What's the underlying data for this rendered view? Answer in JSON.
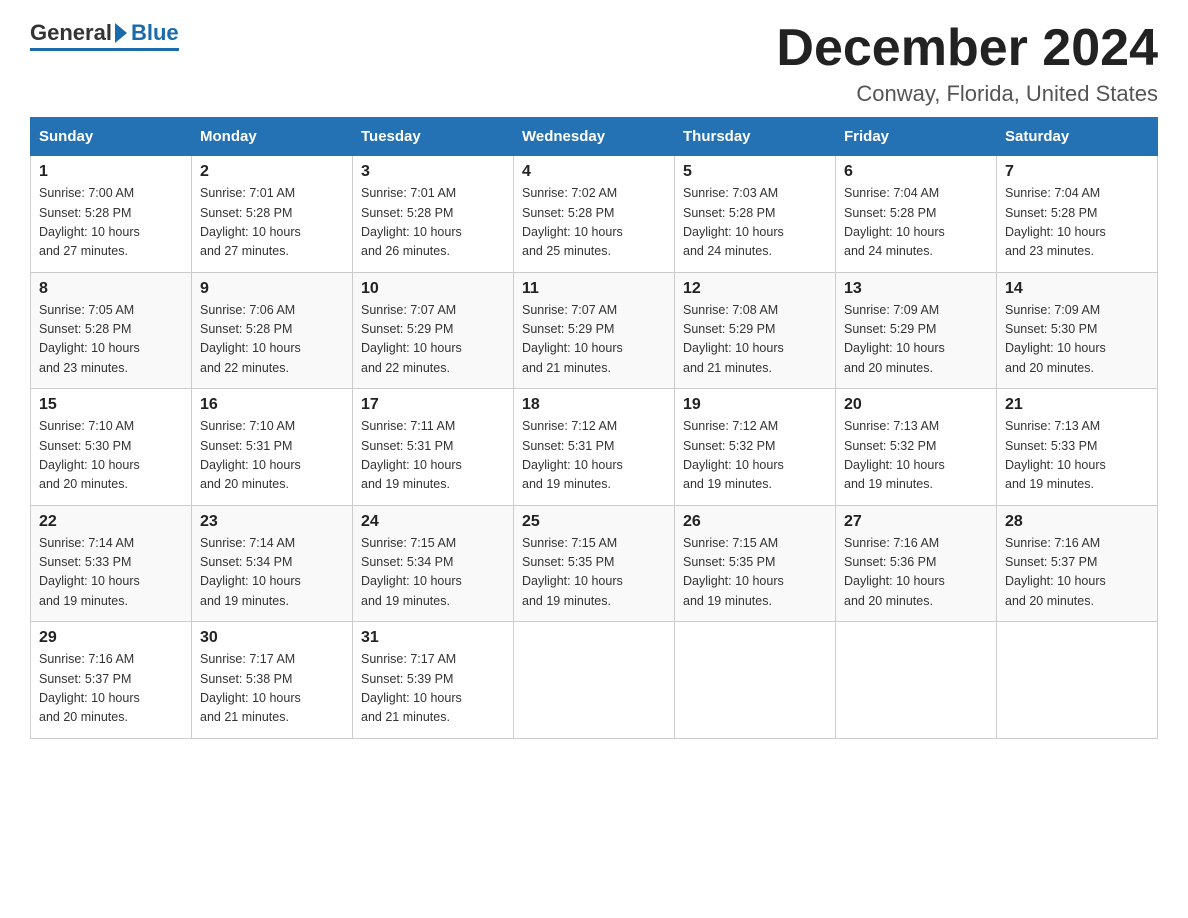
{
  "header": {
    "logo_general": "General",
    "logo_blue": "Blue",
    "month_title": "December 2024",
    "location": "Conway, Florida, United States"
  },
  "days_of_week": [
    "Sunday",
    "Monday",
    "Tuesday",
    "Wednesday",
    "Thursday",
    "Friday",
    "Saturday"
  ],
  "weeks": [
    [
      {
        "num": "1",
        "sunrise": "7:00 AM",
        "sunset": "5:28 PM",
        "daylight": "10 hours and 27 minutes."
      },
      {
        "num": "2",
        "sunrise": "7:01 AM",
        "sunset": "5:28 PM",
        "daylight": "10 hours and 27 minutes."
      },
      {
        "num": "3",
        "sunrise": "7:01 AM",
        "sunset": "5:28 PM",
        "daylight": "10 hours and 26 minutes."
      },
      {
        "num": "4",
        "sunrise": "7:02 AM",
        "sunset": "5:28 PM",
        "daylight": "10 hours and 25 minutes."
      },
      {
        "num": "5",
        "sunrise": "7:03 AM",
        "sunset": "5:28 PM",
        "daylight": "10 hours and 24 minutes."
      },
      {
        "num": "6",
        "sunrise": "7:04 AM",
        "sunset": "5:28 PM",
        "daylight": "10 hours and 24 minutes."
      },
      {
        "num": "7",
        "sunrise": "7:04 AM",
        "sunset": "5:28 PM",
        "daylight": "10 hours and 23 minutes."
      }
    ],
    [
      {
        "num": "8",
        "sunrise": "7:05 AM",
        "sunset": "5:28 PM",
        "daylight": "10 hours and 23 minutes."
      },
      {
        "num": "9",
        "sunrise": "7:06 AM",
        "sunset": "5:28 PM",
        "daylight": "10 hours and 22 minutes."
      },
      {
        "num": "10",
        "sunrise": "7:07 AM",
        "sunset": "5:29 PM",
        "daylight": "10 hours and 22 minutes."
      },
      {
        "num": "11",
        "sunrise": "7:07 AM",
        "sunset": "5:29 PM",
        "daylight": "10 hours and 21 minutes."
      },
      {
        "num": "12",
        "sunrise": "7:08 AM",
        "sunset": "5:29 PM",
        "daylight": "10 hours and 21 minutes."
      },
      {
        "num": "13",
        "sunrise": "7:09 AM",
        "sunset": "5:29 PM",
        "daylight": "10 hours and 20 minutes."
      },
      {
        "num": "14",
        "sunrise": "7:09 AM",
        "sunset": "5:30 PM",
        "daylight": "10 hours and 20 minutes."
      }
    ],
    [
      {
        "num": "15",
        "sunrise": "7:10 AM",
        "sunset": "5:30 PM",
        "daylight": "10 hours and 20 minutes."
      },
      {
        "num": "16",
        "sunrise": "7:10 AM",
        "sunset": "5:31 PM",
        "daylight": "10 hours and 20 minutes."
      },
      {
        "num": "17",
        "sunrise": "7:11 AM",
        "sunset": "5:31 PM",
        "daylight": "10 hours and 19 minutes."
      },
      {
        "num": "18",
        "sunrise": "7:12 AM",
        "sunset": "5:31 PM",
        "daylight": "10 hours and 19 minutes."
      },
      {
        "num": "19",
        "sunrise": "7:12 AM",
        "sunset": "5:32 PM",
        "daylight": "10 hours and 19 minutes."
      },
      {
        "num": "20",
        "sunrise": "7:13 AM",
        "sunset": "5:32 PM",
        "daylight": "10 hours and 19 minutes."
      },
      {
        "num": "21",
        "sunrise": "7:13 AM",
        "sunset": "5:33 PM",
        "daylight": "10 hours and 19 minutes."
      }
    ],
    [
      {
        "num": "22",
        "sunrise": "7:14 AM",
        "sunset": "5:33 PM",
        "daylight": "10 hours and 19 minutes."
      },
      {
        "num": "23",
        "sunrise": "7:14 AM",
        "sunset": "5:34 PM",
        "daylight": "10 hours and 19 minutes."
      },
      {
        "num": "24",
        "sunrise": "7:15 AM",
        "sunset": "5:34 PM",
        "daylight": "10 hours and 19 minutes."
      },
      {
        "num": "25",
        "sunrise": "7:15 AM",
        "sunset": "5:35 PM",
        "daylight": "10 hours and 19 minutes."
      },
      {
        "num": "26",
        "sunrise": "7:15 AM",
        "sunset": "5:35 PM",
        "daylight": "10 hours and 19 minutes."
      },
      {
        "num": "27",
        "sunrise": "7:16 AM",
        "sunset": "5:36 PM",
        "daylight": "10 hours and 20 minutes."
      },
      {
        "num": "28",
        "sunrise": "7:16 AM",
        "sunset": "5:37 PM",
        "daylight": "10 hours and 20 minutes."
      }
    ],
    [
      {
        "num": "29",
        "sunrise": "7:16 AM",
        "sunset": "5:37 PM",
        "daylight": "10 hours and 20 minutes."
      },
      {
        "num": "30",
        "sunrise": "7:17 AM",
        "sunset": "5:38 PM",
        "daylight": "10 hours and 21 minutes."
      },
      {
        "num": "31",
        "sunrise": "7:17 AM",
        "sunset": "5:39 PM",
        "daylight": "10 hours and 21 minutes."
      },
      null,
      null,
      null,
      null
    ]
  ],
  "labels": {
    "sunrise": "Sunrise:",
    "sunset": "Sunset:",
    "daylight": "Daylight:"
  }
}
